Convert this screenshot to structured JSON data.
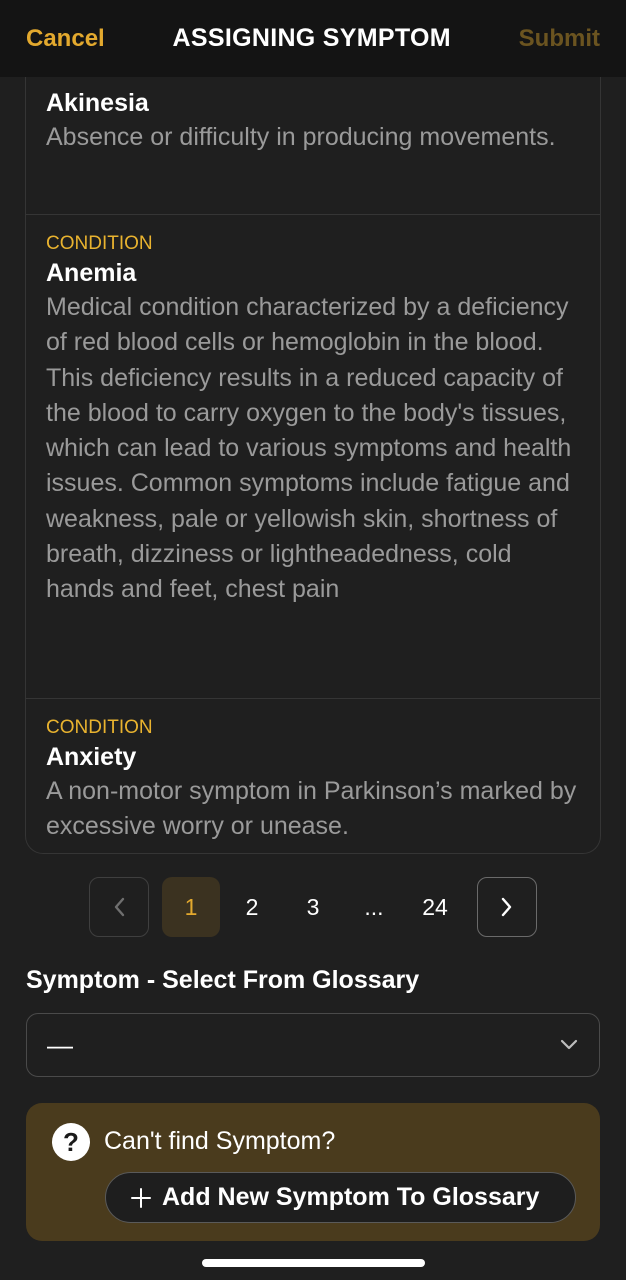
{
  "header": {
    "cancel_label": "Cancel",
    "title": "ASSIGNING SYMPTOM",
    "submit_label": "Submit"
  },
  "glossary": {
    "items": [
      {
        "category": "",
        "name": "Akinesia",
        "description": "Absence or difficulty in producing movements."
      },
      {
        "category": "CONDITION",
        "name": "Anemia",
        "description": "Medical condition characterized by a deficiency of red blood cells or hemoglobin in the blood. This deficiency results in a reduced capacity of the blood to carry oxygen to the body's tissues, which can lead to various symptoms and health issues. Common symptoms include fatigue and weakness, pale or yellowish skin, shortness of breath, dizziness or lightheadedness, cold hands and feet, chest pain"
      },
      {
        "category": "CONDITION",
        "name": "Anxiety",
        "description": "A non-motor symptom in Parkinson’s marked by excessive worry or unease."
      }
    ]
  },
  "pagination": {
    "pages": [
      "1",
      "2",
      "3",
      "...",
      "24"
    ],
    "current": "1",
    "prev_icon": "chevron-left-icon",
    "next_icon": "chevron-right-icon"
  },
  "symptom_field": {
    "label": "Symptom - Select From Glossary",
    "value": "—",
    "icon": "chevron-down-icon"
  },
  "help": {
    "icon": "question-circle-icon",
    "text": "Can't find Symptom?",
    "add_button_label": "Add New Symptom To Glossary",
    "add_icon": "plus-icon"
  },
  "colors": {
    "accent": "#e3a92e",
    "background": "#1f1f1f",
    "help_background": "#4a3b1d"
  }
}
